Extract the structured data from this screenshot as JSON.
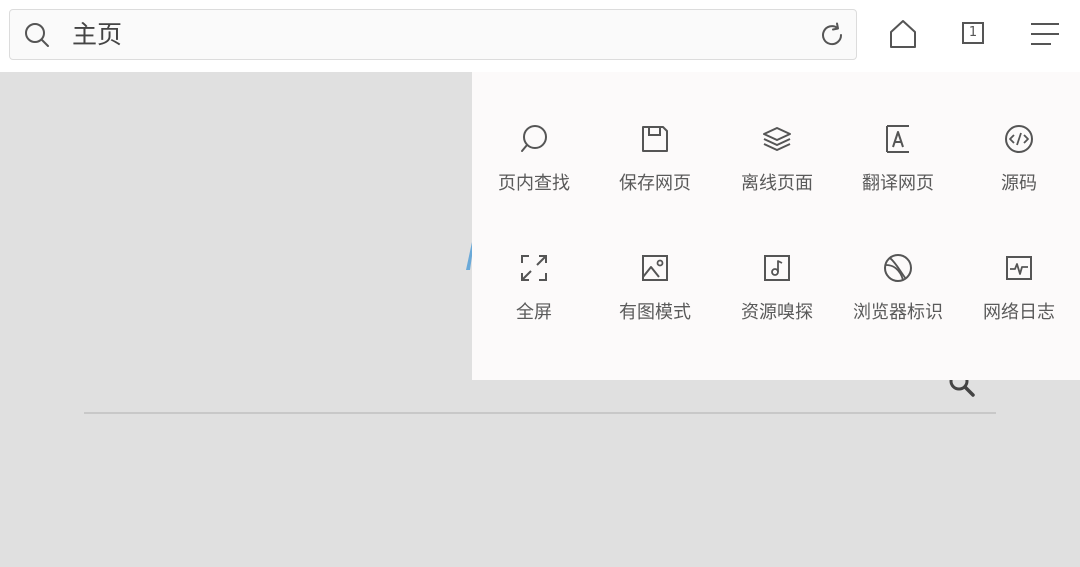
{
  "address_bar": {
    "text": "主页",
    "search_icon": "search-icon",
    "reload_icon": "reload-icon"
  },
  "toolbar": {
    "home_icon": "home-icon",
    "tab_count": "1",
    "menu_icon": "hamburger-menu-icon"
  },
  "menu": {
    "items": [
      {
        "label": "页内查找",
        "icon": "find-in-page-icon"
      },
      {
        "label": "保存网页",
        "icon": "save-icon"
      },
      {
        "label": "离线页面",
        "icon": "layers-icon"
      },
      {
        "label": "翻译网页",
        "icon": "translate-icon"
      },
      {
        "label": "源码",
        "icon": "code-icon"
      },
      {
        "label": "全屏",
        "icon": "fullscreen-icon"
      },
      {
        "label": "有图模式",
        "icon": "image-icon"
      },
      {
        "label": "资源嗅探",
        "icon": "music-file-icon"
      },
      {
        "label": "浏览器标识",
        "icon": "globe-icon"
      },
      {
        "label": "网络日志",
        "icon": "network-log-icon"
      }
    ]
  },
  "colors": {
    "icon": "#555555",
    "page_background": "#e0e0e0",
    "menu_background": "#fcfafa"
  }
}
